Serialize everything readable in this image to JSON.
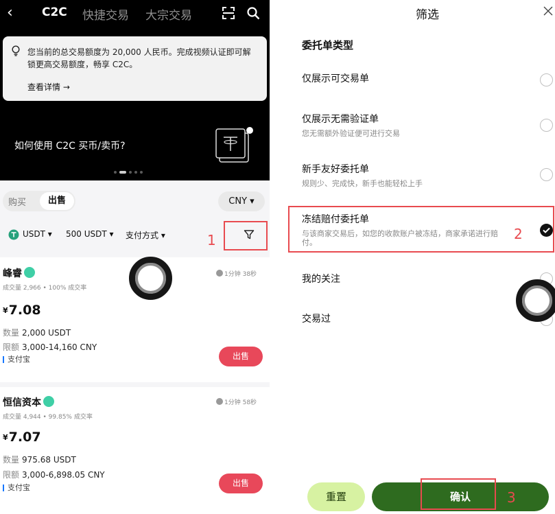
{
  "header": {
    "tabs": [
      "C2C",
      "快捷交易",
      "大宗交易"
    ]
  },
  "notice": {
    "text": "您当前的总交易额度为 20,000 人民币。完成视频认证即可解锁更高交易额度，畅享 C2C。",
    "link": "查看详情 →"
  },
  "banner": {
    "title": "如何使用 C2C 买币/卖币?"
  },
  "mode": {
    "buy": "购买",
    "sell": "出售",
    "currency": "CNY ▾"
  },
  "filters": {
    "coin": "USDT ▾",
    "amount": "500 USDT ▾",
    "payment": "支付方式 ▾"
  },
  "annotations": [
    "1",
    "2",
    "3"
  ],
  "listings": [
    {
      "name": "峰睿",
      "stats": "成交量 2,966 • 100% 成交率",
      "time": "1分钟 38秒",
      "price": "7.08",
      "quantity_label": "数量",
      "quantity": "2,000 USDT",
      "limit_label": "限额",
      "limit": "3,000-14,160 CNY",
      "payment": "支付宝",
      "action": "出售"
    },
    {
      "name": "恒信资本",
      "stats": "成交量 4,944 • 99.85% 成交率",
      "time": "1分钟 58秒",
      "price": "7.07",
      "quantity_label": "数量",
      "quantity": "975.68 USDT",
      "limit_label": "限额",
      "limit": "3,000-6,898.05 CNY",
      "payment": "支付宝",
      "action": "出售"
    }
  ],
  "currency_symbol": "¥",
  "filter_panel": {
    "title": "筛选",
    "section": "委托单类型",
    "options": [
      {
        "label": "仅展示可交易单",
        "sub": "",
        "checked": false
      },
      {
        "label": "仅展示无需验证单",
        "sub": "您无需额外验证便可进行交易",
        "checked": false
      },
      {
        "label": "新手友好委托单",
        "sub": "规则少、完成快，新手也能轻松上手",
        "checked": false
      },
      {
        "label": "冻结赔付委托单",
        "sub": "与该商家交易后，如您的收款账户被冻结，商家承诺进行赔付。",
        "checked": true
      },
      {
        "label": "我的关注",
        "sub": "",
        "checked": false
      },
      {
        "label": "交易过",
        "sub": "",
        "checked": false
      }
    ],
    "reset": "重置",
    "confirm": "确认"
  },
  "colors": {
    "sell_button": "#e8485a",
    "annotation_red": "#e84a4f",
    "confirm_green": "#2e6b1f",
    "reset_green": "#d7f2a2",
    "verify_badge": "#3fcfa6"
  }
}
